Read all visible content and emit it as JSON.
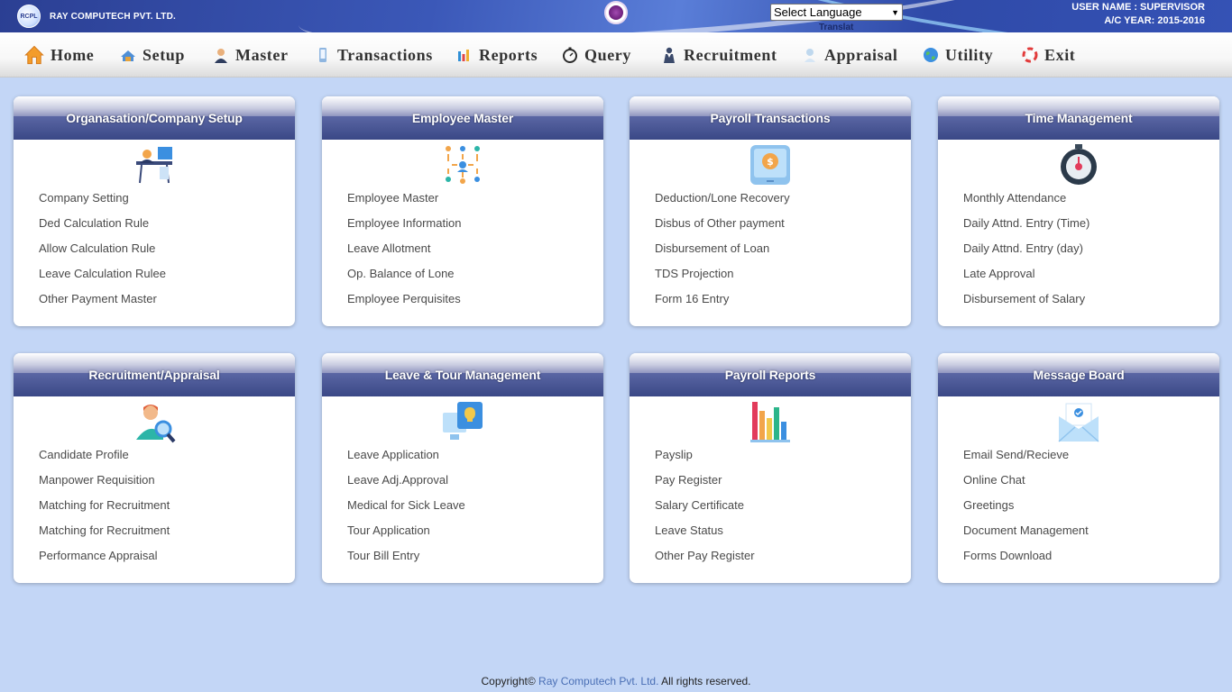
{
  "header": {
    "logo_text": "RCPL",
    "company_name": "RAY COMPUTECH PVT. LTD.",
    "language_select": "Select Language",
    "translate_hint": "Translat",
    "user_label": "USER NAME : SUPERVISOR",
    "year_label": "A/C YEAR: 2015-2016"
  },
  "menu": [
    {
      "label": "Home",
      "icon": "home-icon"
    },
    {
      "label": "Setup",
      "icon": "setup-icon"
    },
    {
      "label": "Master",
      "icon": "user-icon"
    },
    {
      "label": "Transactions",
      "icon": "phone-icon"
    },
    {
      "label": "Reports",
      "icon": "bar-chart-icon"
    },
    {
      "label": "Query",
      "icon": "stopwatch-icon"
    },
    {
      "label": "Recruitment",
      "icon": "person-icon"
    },
    {
      "label": "Appraisal",
      "icon": "appraisal-icon"
    },
    {
      "label": "Utility",
      "icon": "globe-icon"
    },
    {
      "label": "Exit",
      "icon": "exit-icon"
    }
  ],
  "cards": [
    {
      "title": "Organasation/Company Setup",
      "icon": "desk-setup-icon",
      "links": [
        "Company Setting",
        "Ded Calculation Rule",
        "Allow Calculation Rule",
        "Leave Calculation Rulee",
        "Other Payment Master"
      ]
    },
    {
      "title": "Employee Master",
      "icon": "org-chart-icon",
      "links": [
        "Employee Master",
        "Employee Information",
        "Leave Allotment",
        "Op. Balance of Lone",
        "Employee Perquisites"
      ]
    },
    {
      "title": "Payroll Transactions",
      "icon": "payment-tablet-icon",
      "links": [
        "Deduction/Lone Recovery",
        "Disbus of Other payment",
        "Disbursement of Loan",
        "TDS Projection",
        "Form 16 Entry"
      ]
    },
    {
      "title": "Time Management",
      "icon": "stopwatch-icon",
      "links": [
        "Monthly Attendance",
        "Daily Attnd. Entry (Time)",
        "Daily Attnd. Entry (day)",
        "Late Approval",
        "Disbursement of Salary"
      ]
    },
    {
      "title": "Recruitment/Appraisal",
      "icon": "candidate-search-icon",
      "links": [
        "Candidate Profile",
        "Manpower Requisition",
        "Matching for Recruitment",
        "Matching for Recruitment",
        "Performance Appraisal"
      ]
    },
    {
      "title": "Leave & Tour Management",
      "icon": "idea-device-icon",
      "links": [
        "Leave Application",
        "Leave Adj.Approval",
        "Medical for Sick Leave",
        "Tour Application",
        "Tour Bill Entry"
      ]
    },
    {
      "title": "Payroll Reports",
      "icon": "bar-chart-icon",
      "links": [
        "Payslip",
        "Pay Register",
        "Salary Certificate",
        "Leave Status",
        "Other Pay Register"
      ]
    },
    {
      "title": "Message Board",
      "icon": "mail-icon",
      "links": [
        "Email Send/Recieve",
        "Online Chat",
        "Greetings",
        "Document Management",
        "Forms Download"
      ]
    }
  ],
  "footer": {
    "prefix": "Copyright© ",
    "brand": "Ray Computech Pvt. Ltd.",
    "suffix": " All rights reserved."
  }
}
